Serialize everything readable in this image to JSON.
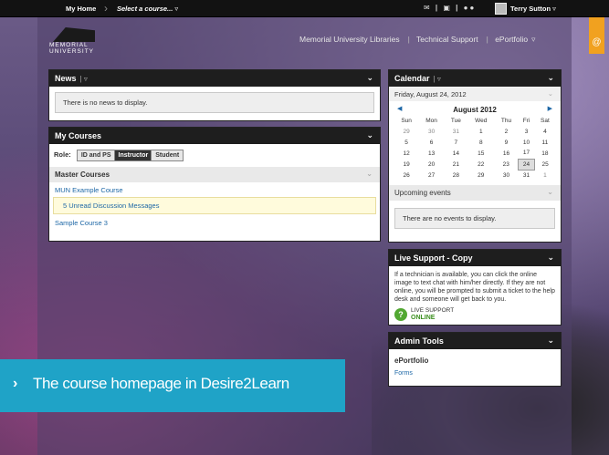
{
  "topbar": {
    "home": "My Home",
    "course_select": "Select a course...",
    "user": "Terry Sutton"
  },
  "logo": {
    "line1": "MEMORIAL",
    "line2": "UNIVERSITY"
  },
  "navlinks": [
    "Memorial University Libraries",
    "Technical Support",
    "ePortfolio"
  ],
  "news": {
    "title": "News",
    "message": "There is no news to display."
  },
  "my_courses": {
    "title": "My Courses",
    "role_label": "Role:",
    "roles": [
      "ID and PS",
      "Instructor",
      "Student"
    ],
    "selected_role": "Instructor",
    "section": "Master Courses",
    "course1": "MUN Example Course",
    "unread": "5 Unread Discussion Messages",
    "course2": "Sample Course 3"
  },
  "calendar": {
    "title": "Calendar",
    "date": "Friday, August 24, 2012",
    "month": "August 2012",
    "days": [
      "Sun",
      "Mon",
      "Tue",
      "Wed",
      "Thu",
      "Fri",
      "Sat"
    ],
    "weeks": [
      [
        "29",
        "30",
        "31",
        "1",
        "2",
        "3",
        "4"
      ],
      [
        "5",
        "6",
        "7",
        "8",
        "9",
        "10",
        "11"
      ],
      [
        "12",
        "13",
        "14",
        "15",
        "16",
        "17",
        "18"
      ],
      [
        "19",
        "20",
        "21",
        "22",
        "23",
        "24",
        "25"
      ],
      [
        "26",
        "27",
        "28",
        "29",
        "30",
        "31",
        "1"
      ]
    ],
    "upcoming_title": "Upcoming events",
    "upcoming_message": "There are no events to display."
  },
  "live_support": {
    "title": "Live Support - Copy",
    "text": "If a technician is available, you can click the online image to text chat with him/her directly. If they are not online, you will be prompted to submit a ticket to the help desk and someone will get back to you.",
    "badge_line1": "LIVE SUPPORT",
    "badge_line2": "ONLINE"
  },
  "admin_tools": {
    "title": "Admin Tools",
    "heading": "ePortfolio",
    "link": "Forms"
  },
  "banner": {
    "text": "The course homepage in Desire2Learn"
  }
}
